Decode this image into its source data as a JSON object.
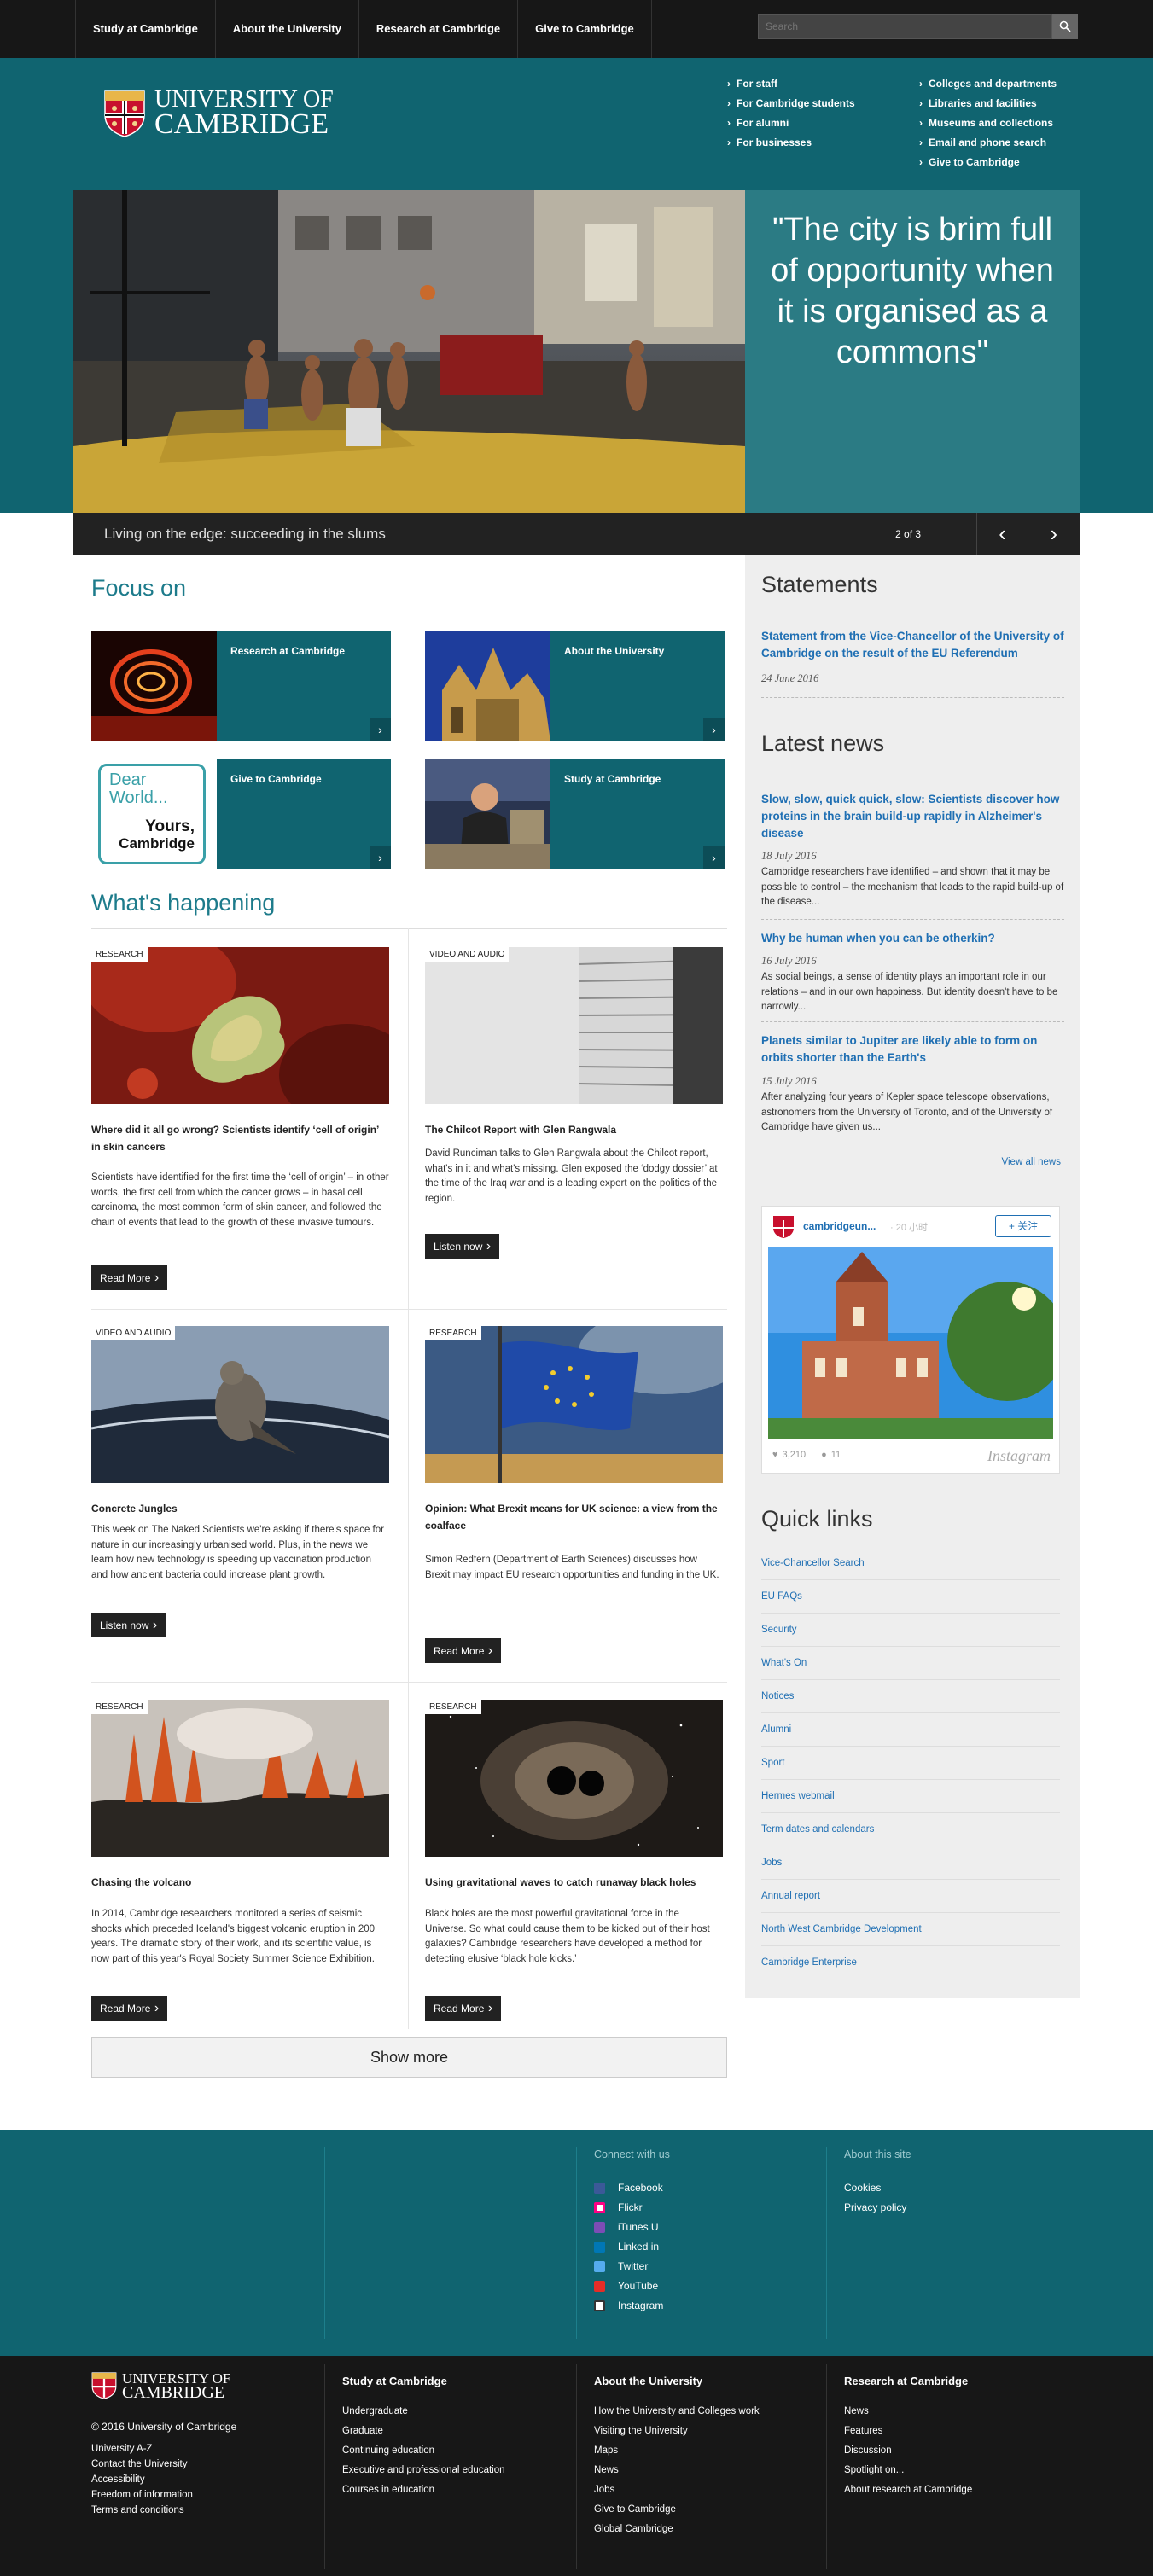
{
  "topnav": [
    "Study at Cambridge",
    "About the University",
    "Research at Cambridge",
    "Give to Cambridge"
  ],
  "search_placeholder": "Search",
  "logo": {
    "line1": "UNIVERSITY OF",
    "line2": "CAMBRIDGE"
  },
  "header_links_left": [
    "For staff",
    "For Cambridge students",
    "For alumni",
    "For businesses"
  ],
  "header_links_right": [
    "Colleges and departments",
    "Libraries and facilities",
    "Museums and collections",
    "Email and phone search",
    "Give to Cambridge"
  ],
  "hero": {
    "quote": "\"The city is brim full of opportunity when it is organised as a commons\"",
    "caption": "Living on the edge: succeeding in the slums",
    "counter": "2 of 3"
  },
  "focus": {
    "title": "Focus on",
    "tiles": [
      "Research at Cambridge",
      "About the University",
      "Give to Cambridge",
      "Study at Cambridge"
    ],
    "give_card": {
      "line1": "Dear",
      "line2": "World...",
      "line3": "Yours,",
      "line4": "Cambridge"
    }
  },
  "happening": {
    "title": "What's happening",
    "cards": [
      {
        "tag": "RESEARCH",
        "title": "Where did it all go wrong? Scientists identify ‘cell of origin’ in skin cancers",
        "text": "Scientists have identified for the first time the ‘cell of origin’ – in other words, the first cell from which the cancer grows – in basal cell carcinoma, the most common form of skin cancer, and followed the chain of events that lead to the growth of these invasive tumours.",
        "button": "Read More"
      },
      {
        "tag": "VIDEO AND AUDIO",
        "title": "The Chilcot Report with Glen Rangwala",
        "text": "David Runciman talks to Glen Rangwala about the Chilcot report, what's in it and what's missing. Glen exposed the ‘dodgy dossier’ at the time of the Iraq war and is a leading expert on the politics of the region.",
        "button": "Listen now"
      },
      {
        "tag": "VIDEO AND AUDIO",
        "title": "Concrete Jungles",
        "text": "This week on The Naked Scientists we're asking if there's space for nature in our increasingly urbanised world. Plus, in the news we learn how new technology is speeding up vaccination production and how ancient bacteria could increase plant growth.",
        "button": "Listen now"
      },
      {
        "tag": "RESEARCH",
        "title": "Opinion: What Brexit means for UK science: a view from the coalface",
        "text": "Simon Redfern (Department of Earth Sciences) discusses how Brexit may impact EU research opportunities and funding in the UK.",
        "button": "Read More"
      },
      {
        "tag": "RESEARCH",
        "title": "Chasing the volcano",
        "text": "In 2014, Cambridge researchers monitored a series of seismic shocks which preceded Iceland's biggest volcanic eruption in 200 years. The dramatic story of their work, and its scientific value, is now part of this year's Royal Society Summer Science Exhibition.",
        "button": "Read More"
      },
      {
        "tag": "RESEARCH",
        "title": "Using gravitational waves to catch runaway black holes",
        "text": "Black holes are the most powerful gravitational force in the Universe. So what could cause them to be kicked out of their host galaxies? Cambridge researchers have developed a method for detecting elusive ‘black hole kicks.’",
        "button": "Read More"
      }
    ],
    "show_more": "Show more"
  },
  "statements": {
    "title": "Statements",
    "item_title": "Statement from the Vice-Chancellor of the University of Cambridge on the result of the EU Referendum",
    "item_date": "24 June 2016"
  },
  "news": {
    "title": "Latest news",
    "items": [
      {
        "title": "Slow, slow, quick quick, slow: Scientists discover how proteins in the brain build-up rapidly in Alzheimer's disease",
        "date": "18 July 2016",
        "text": "Cambridge researchers have identified – and shown that it may be possible to control – the mechanism that leads to the rapid build-up of the disease..."
      },
      {
        "title": "Why be human when you can be otherkin?",
        "date": "16 July 2016",
        "text": "As social beings, a sense of identity plays an important role in our relations – and in our own happiness. But identity doesn't have to be narrowly..."
      },
      {
        "title": "Planets similar to Jupiter are likely able to form on orbits shorter than the Earth's",
        "date": "15 July 2016",
        "text": "After analyzing four years of Kepler space telescope observations, astronomers from the University of Toronto, and of the University of Cambridge have given us..."
      }
    ],
    "view_all": "View all news"
  },
  "instagram": {
    "account": "cambridgeun...",
    "time": "· 20 小时",
    "follow": "+ 关注",
    "likes": "3,210",
    "comments": "11",
    "brand": "Instagram"
  },
  "quick_links": {
    "title": "Quick links",
    "items": [
      "Vice-Chancellor Search",
      "EU FAQs",
      "Security",
      "What's On",
      "Notices",
      "Alumni",
      "Sport",
      "Hermes webmail",
      "Term dates and calendars",
      "Jobs",
      "Annual report",
      "North West Cambridge Development",
      "Cambridge Enterprise"
    ]
  },
  "footer_connect": {
    "title": "Connect with us",
    "items": [
      {
        "label": "Facebook",
        "color": "#3b5998"
      },
      {
        "label": "Flickr",
        "color": "#ff0084"
      },
      {
        "label": "iTunes U",
        "color": "#7c4db5"
      },
      {
        "label": "Linked in",
        "color": "#0077b5"
      },
      {
        "label": "Twitter",
        "color": "#55acee"
      },
      {
        "label": "YouTube",
        "color": "#e52d27"
      },
      {
        "label": "Instagram",
        "color": "#ffffff"
      }
    ]
  },
  "footer_about": {
    "title": "About this site",
    "items": [
      "Cookies",
      "Privacy policy"
    ]
  },
  "footer_bottom": {
    "copyright": "© 2016 University of Cambridge",
    "links": [
      "University A-Z",
      "Contact the University",
      "Accessibility",
      "Freedom of information",
      "Terms and conditions"
    ],
    "study": {
      "title": "Study at Cambridge",
      "items": [
        "Undergraduate",
        "Graduate",
        "Continuing education",
        "Executive and professional education",
        "Courses in education"
      ]
    },
    "about": {
      "title": "About the University",
      "items": [
        "How the University and Colleges work",
        "Visiting the University",
        "Maps",
        "News",
        "Jobs",
        "Give to Cambridge",
        "Global Cambridge"
      ]
    },
    "research": {
      "title": "Research at Cambridge",
      "items": [
        "News",
        "Features",
        "Discussion",
        "Spotlight on...",
        "About research at Cambridge"
      ]
    }
  }
}
